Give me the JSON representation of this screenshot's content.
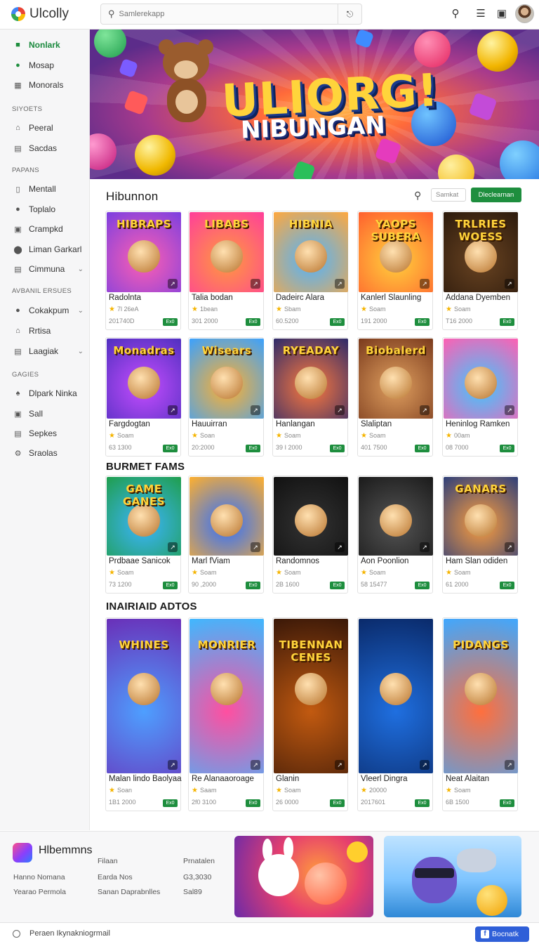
{
  "header": {
    "app_name": "Ulcolly",
    "search_placeholder": "Samlerekapp"
  },
  "sidebar": {
    "items": [
      {
        "label": "Nonlark",
        "icon": "square-icon"
      },
      {
        "label": "Mosap",
        "icon": "circle-icon"
      },
      {
        "label": "Monorals",
        "icon": "grid-icon"
      },
      {
        "label": "Peeral",
        "icon": "home-icon"
      },
      {
        "label": "Sacdas",
        "icon": "list-icon"
      },
      {
        "label": "Mentall",
        "icon": "book-icon"
      },
      {
        "label": "Toplalo",
        "icon": "person-icon"
      },
      {
        "label": "Crampkd",
        "icon": "box-icon"
      },
      {
        "label": "Liman Garkarl",
        "icon": "circle-icon"
      },
      {
        "label": "Cimmuna",
        "icon": "list-icon"
      },
      {
        "label": "Cokakpum",
        "icon": "person-icon"
      },
      {
        "label": "Rrtisa",
        "icon": "home-icon"
      },
      {
        "label": "Laagiak",
        "icon": "list-icon"
      },
      {
        "label": "Dlpark Ninka",
        "icon": "puzzle-icon"
      },
      {
        "label": "Sall",
        "icon": "box-icon"
      },
      {
        "label": "Sepkes",
        "icon": "list-icon"
      },
      {
        "label": "Sraolas",
        "icon": "gear-icon"
      }
    ],
    "sections": [
      "SIYOETS",
      "PAPANS",
      "AVBANIL ERSUES",
      "GAGIES"
    ]
  },
  "hero": {
    "title": "ULIORG!",
    "subtitle": "NIBUNGAN"
  },
  "main": {
    "section1_title": "Hibunnon",
    "section1_search_placeholder": "Samkat",
    "section1_button": "Dleclearnan",
    "section2_title": "BURMET FAMS",
    "section3_title": "INAIRIAID ADTOS",
    "cards": [
      {
        "art": "HIBRAPS",
        "name": "Radolnta",
        "rating": "7l 26eA",
        "meta": "201740D"
      },
      {
        "art": "LIBABS",
        "name": "Talia bodan",
        "rating": "1bean",
        "meta": "301 2000"
      },
      {
        "art": "HIBNIA",
        "name": "Dadeirc Alara",
        "rating": "Sbam",
        "meta": "60.5200"
      },
      {
        "art": "YAOPS SUBERA",
        "name": "Kanlerl Slaunling",
        "rating": "Soam",
        "meta": "191 2000"
      },
      {
        "art": "TRLRIES WOESS",
        "name": "Addana Dyemben",
        "rating": "Soam",
        "meta": "T16 2000"
      },
      {
        "art": "Monadras",
        "name": "Fargdogtan",
        "rating": "Soam",
        "meta": "63 1300"
      },
      {
        "art": "Wisears",
        "name": "Hauuirran",
        "rating": "Soan",
        "meta": "20:2000"
      },
      {
        "art": "RYEADAY",
        "name": "Hanlangan",
        "rating": "Soam",
        "meta": "39 I 2000"
      },
      {
        "art": "Biobalerd",
        "name": "Slaliptan",
        "rating": "Soam",
        "meta": "401 7500"
      },
      {
        "art": "",
        "name": "Heninlog Ramken",
        "rating": "00am",
        "meta": "08 7000"
      },
      {
        "art": "GAME GANES",
        "name": "Prdbaae Sanicok",
        "rating": "Soam",
        "meta": "73 1200"
      },
      {
        "art": "",
        "name": "Marl fViam",
        "rating": "Soam",
        "meta": "90 ,2000"
      },
      {
        "art": "",
        "name": "Randomnos",
        "rating": "Soam",
        "meta": "2B 1600"
      },
      {
        "art": "",
        "name": "Aon Poonlion",
        "rating": "Soam",
        "meta": "58 15477"
      },
      {
        "art": "GANARS",
        "name": "Ham Slan odiden",
        "rating": "Soam",
        "meta": "61 2000"
      },
      {
        "art": "WHINES",
        "name": "Malan lindo Baolyaa",
        "rating": "Soan",
        "meta": "1B1 2000"
      },
      {
        "art": "MONRIER",
        "name": "Re Alanaaoroage",
        "rating": "Saam",
        "meta": "2f0 3100"
      },
      {
        "art": "TIBENNAN CENES",
        "name": "Glanin",
        "rating": "Soam",
        "meta": "26 0000"
      },
      {
        "art": "",
        "name": "Vleerl Dingra",
        "rating": "20000",
        "meta": "2017601"
      },
      {
        "art": "PIDANGS",
        "name": "Neat Alaitan",
        "rating": "Soam",
        "meta": "6B 1500"
      }
    ],
    "badge": "Ex0"
  },
  "footer": {
    "title": "Hlbemmns",
    "col1": [
      "Hanno Nomana",
      "Yearao Permola"
    ],
    "col2": [
      "Filaan",
      "Earda Nos",
      "Sanan Daprabnlles"
    ],
    "col3": [
      "Prnatalen",
      "G3,3030",
      "Sal89"
    ]
  },
  "bottom_bar": {
    "text": "Peraen Ikynakniogrmail",
    "button": "Bocnatk"
  },
  "colors": {
    "accent": "#1e8e3e",
    "facebook": "#2f5fd8"
  }
}
